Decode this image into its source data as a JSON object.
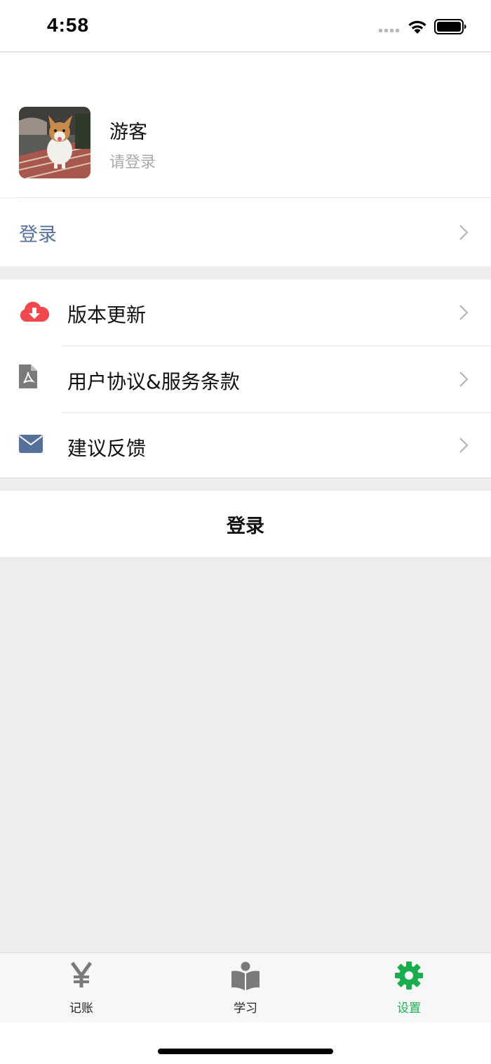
{
  "status_bar": {
    "time": "4:58"
  },
  "profile": {
    "name": "游客",
    "subtitle": "请登录"
  },
  "login_row": {
    "label": "登录"
  },
  "menu": {
    "items": [
      {
        "label": "版本更新",
        "icon": "cloud-download-icon",
        "icon_color": "#f0484e"
      },
      {
        "label": "用户协议&服务条款",
        "icon": "pdf-document-icon",
        "icon_color": "#7a7a7a"
      },
      {
        "label": "建议反馈",
        "icon": "envelope-icon",
        "icon_color": "#57709a"
      }
    ]
  },
  "login_button": {
    "label": "登录"
  },
  "tab_bar": {
    "tabs": [
      {
        "label": "记账",
        "icon": "yen-icon",
        "active": false
      },
      {
        "label": "学习",
        "icon": "reading-person-icon",
        "active": false
      },
      {
        "label": "设置",
        "icon": "gear-icon",
        "active": true
      }
    ],
    "active_color": "#1aad4e"
  },
  "colors": {
    "link_blue": "#57709a",
    "background_gray": "#ededed"
  }
}
